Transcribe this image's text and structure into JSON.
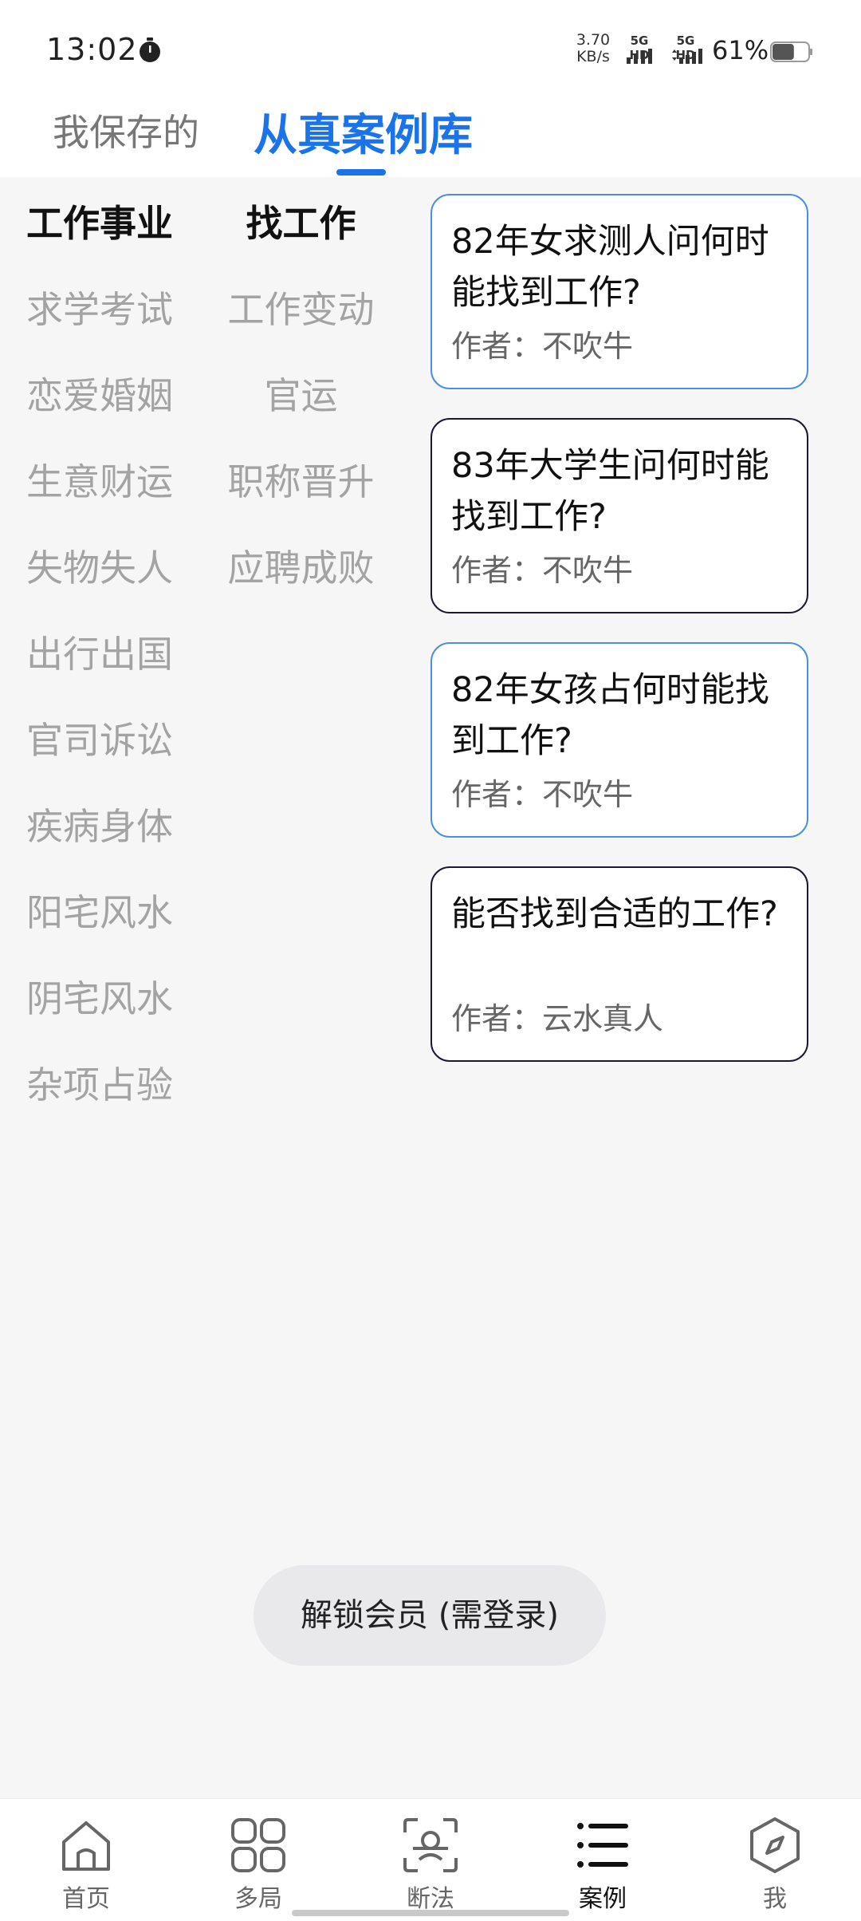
{
  "status_bar": {
    "time": "13:02",
    "net_speed_value": "3.70",
    "net_speed_unit": "KB/s",
    "sim1_label": "5G HD",
    "sim2_label": "5G HD",
    "battery_percent": "61%",
    "battery_level": 0.61
  },
  "top_tabs": {
    "saved_label": "我保存的",
    "library_label": "从真案例库"
  },
  "categories": {
    "main": [
      "工作事业",
      "求学考试",
      "恋爱婚姻",
      "生意财运",
      "失物失人",
      "出行出国",
      "官司诉讼",
      "疾病身体",
      "阳宅风水",
      "阴宅风水",
      "杂项占验"
    ],
    "sub": [
      "找工作",
      "工作变动",
      "官运",
      "职称晋升",
      "应聘成败"
    ]
  },
  "cases": [
    {
      "title": "82年女求测人问何时能找到工作?",
      "author": "作者：不吹牛"
    },
    {
      "title": "83年大学生问何时能找到工作?",
      "author": "作者：不吹牛"
    },
    {
      "title": "82年女孩占何时能找到工作?",
      "author": "作者：不吹牛"
    },
    {
      "title": "能否找到合适的工作?",
      "author": "作者：云水真人"
    }
  ],
  "unlock_label": "解锁会员 (需登录)",
  "bottom_nav": [
    {
      "label": "首页",
      "icon": "home-icon"
    },
    {
      "label": "多局",
      "icon": "grid-icon"
    },
    {
      "label": "断法",
      "icon": "scan-icon"
    },
    {
      "label": "案例",
      "icon": "list-icon"
    },
    {
      "label": "我",
      "icon": "compass-icon"
    }
  ],
  "colors": {
    "accent": "#1a73e8",
    "card_border_dark": "#1a1a2e",
    "card_border_blue": "#4a8fe0"
  }
}
